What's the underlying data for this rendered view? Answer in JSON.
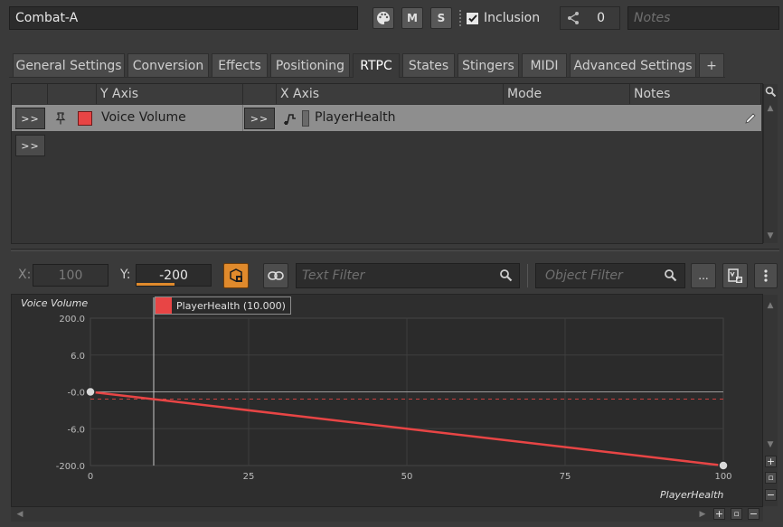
{
  "header": {
    "object_name": "Combat-A",
    "mute_label": "M",
    "solo_label": "S",
    "inclusion_label": "Inclusion",
    "share_count": "0",
    "notes_placeholder": "Notes"
  },
  "tabs": [
    {
      "label": "General Settings"
    },
    {
      "label": "Conversion"
    },
    {
      "label": "Effects"
    },
    {
      "label": "Positioning"
    },
    {
      "label": "RTPC"
    },
    {
      "label": "States"
    },
    {
      "label": "Stingers"
    },
    {
      "label": "MIDI"
    },
    {
      "label": "Advanced Settings"
    },
    {
      "label": "+"
    }
  ],
  "rtpc_table": {
    "columns": {
      "y_axis": "Y Axis",
      "x_axis": "X Axis",
      "mode": "Mode",
      "notes": "Notes"
    },
    "row": {
      "expand": ">>",
      "y_param": "Voice Volume",
      "x_expand": ">>",
      "x_param": "PlayerHealth",
      "color": "#e84545"
    },
    "empty_row_expand": ">>"
  },
  "toolbar": {
    "x_label": "X:",
    "x_value": "100",
    "y_label": "Y:",
    "y_value": "-200",
    "text_filter_placeholder": "Text Filter",
    "object_filter_placeholder": "Object Filter",
    "more_label": "..."
  },
  "graph": {
    "y_title": "Voice Volume",
    "x_title": "PlayerHealth",
    "legend_label": "PlayerHealth (10.000)",
    "legend_color": "#e84545",
    "y_ticks": [
      "200.0",
      "6.0",
      "-0.0",
      "-6.0",
      "-200.0"
    ],
    "x_ticks": [
      "0",
      "25",
      "50",
      "75",
      "100"
    ],
    "cursor_x": 10,
    "curve_color": "#e84545"
  },
  "chart_data": {
    "type": "line",
    "title": "",
    "xlabel": "PlayerHealth",
    "ylabel": "Voice Volume",
    "xlim": [
      0,
      100
    ],
    "series": [
      {
        "name": "Voice Volume",
        "x": [
          0,
          100
        ],
        "y": [
          0,
          -200
        ]
      }
    ]
  }
}
